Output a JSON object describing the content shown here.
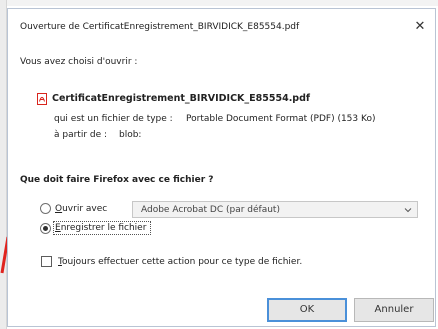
{
  "dialog": {
    "title": "Ouverture de CertificatEnregistrement_BIRVIDICK_E85554.pdf",
    "close_glyph": "✕"
  },
  "file": {
    "intro": "Vous avez choisi d'ouvrir :",
    "icon": "pdf-file-icon",
    "name": "CertificatEnregistrement_BIRVIDICK_E85554.pdf",
    "type_label": "qui est un fichier de type :",
    "type_value": "Portable Document Format (PDF) (153 Ko)",
    "from_label": "à partir de :",
    "from_value": "blob:"
  },
  "question": "Que doit faire Firefox avec ce fichier ?",
  "options": {
    "open_with": {
      "label_first": "O",
      "label_rest": "uvrir avec",
      "selected": false,
      "app": "Adobe Acrobat DC (par défaut)"
    },
    "save": {
      "label_first": "E",
      "label_rest": "nregistrer le fichier",
      "selected": true
    }
  },
  "always": {
    "label_first": "T",
    "label_rest": "oujours effectuer cette action pour ce type de fichier.",
    "checked": false
  },
  "buttons": {
    "ok": "OK",
    "cancel": "Annuler"
  },
  "colors": {
    "accent": "#4a90d9",
    "pdf_red": "#d9251d",
    "annotation_red": "#e0241f"
  }
}
